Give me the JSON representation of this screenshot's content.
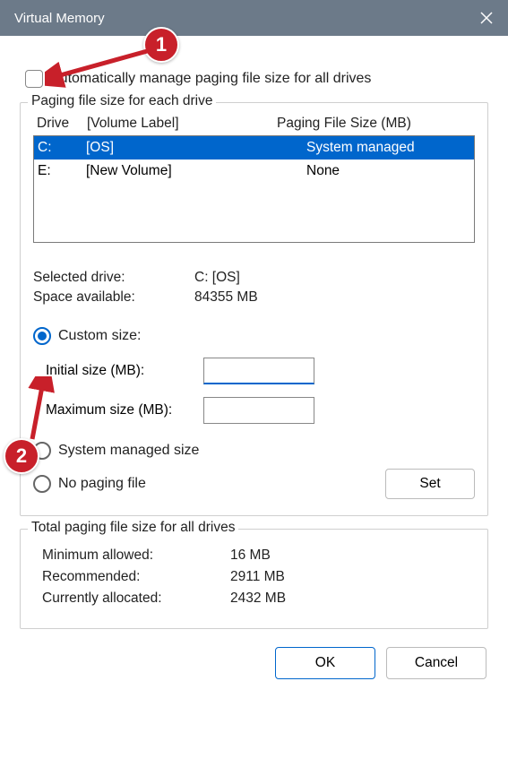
{
  "window": {
    "title": "Virtual Memory"
  },
  "autoManage": {
    "label": "Automatically manage paging file size for all drives",
    "checked": false
  },
  "driveSection": {
    "groupLabel": "Paging file size for each drive",
    "headers": {
      "drive": "Drive",
      "volume": "[Volume Label]",
      "paging": "Paging File Size (MB)"
    },
    "rows": [
      {
        "drive": "C:",
        "volume": "[OS]",
        "paging": "System managed",
        "selected": true
      },
      {
        "drive": "E:",
        "volume": "[New Volume]",
        "paging": "None",
        "selected": false
      }
    ],
    "selectedDriveLabel": "Selected drive:",
    "selectedDriveValue": "C:  [OS]",
    "spaceAvailableLabel": "Space available:",
    "spaceAvailableValue": "84355 MB",
    "customSizeLabel": "Custom size:",
    "initialSizeLabel": "Initial size (MB):",
    "initialSizeValue": "",
    "maximumSizeLabel": "Maximum size (MB):",
    "maximumSizeValue": "",
    "systemManagedLabel": "System managed size",
    "noPagingLabel": "No paging file",
    "setButton": "Set"
  },
  "totals": {
    "groupLabel": "Total paging file size for all drives",
    "minLabel": "Minimum allowed:",
    "minValue": "16 MB",
    "recLabel": "Recommended:",
    "recValue": "2911 MB",
    "curLabel": "Currently allocated:",
    "curValue": "2432 MB"
  },
  "buttons": {
    "ok": "OK",
    "cancel": "Cancel"
  },
  "annotations": {
    "one": "1",
    "two": "2"
  }
}
